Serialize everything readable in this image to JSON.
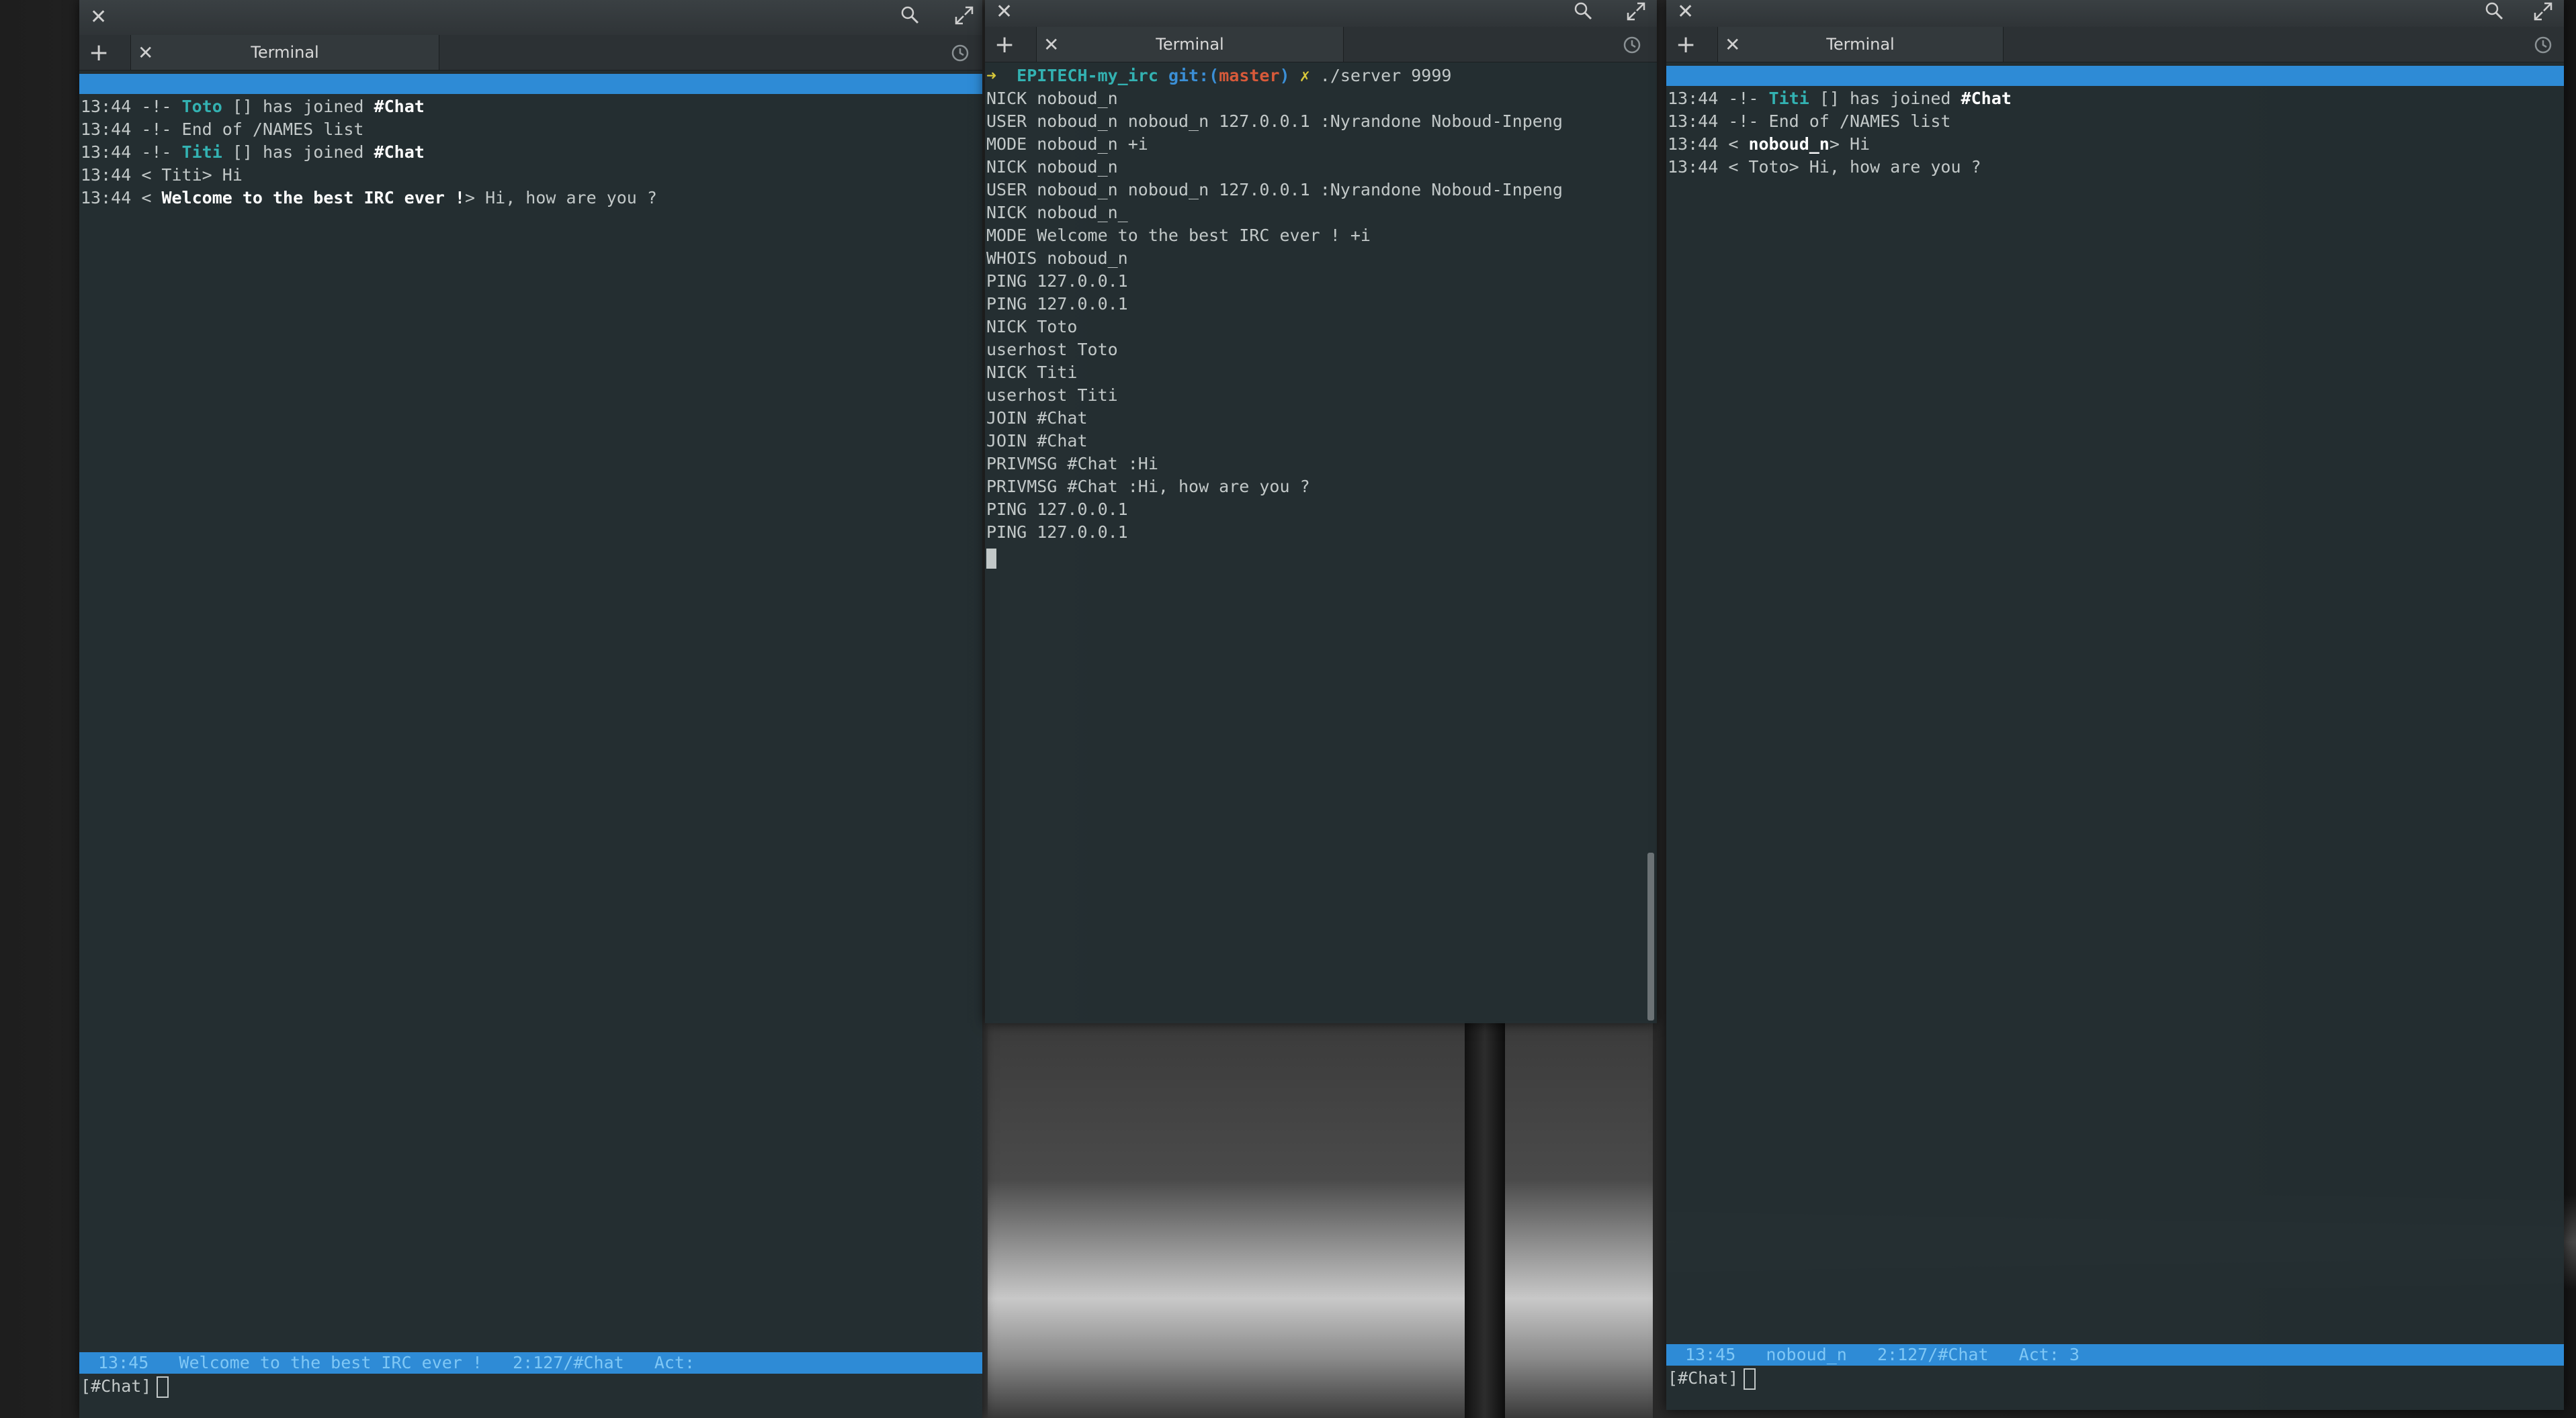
{
  "windows": {
    "left": {
      "tab_title": "Terminal",
      "lines": [
        {
          "time": "13:44",
          "marker": "-!-",
          "nick": "Toto",
          "mid": " [] has joined ",
          "chan": "#Chat"
        },
        {
          "time": "13:44",
          "marker": "-!-",
          "text": " End of /NAMES list"
        },
        {
          "time": "13:44",
          "marker": "-!-",
          "nick": "Titi",
          "mid": " [] has joined ",
          "chan": "#Chat"
        },
        {
          "time": "13:44",
          "plain": "< Titi> Hi"
        },
        {
          "time": "13:44",
          "pre": "< ",
          "bold": "Welcome to the best IRC ever !",
          "post": "> Hi, how are you ?"
        }
      ],
      "status": "13:45   Welcome to the best IRC ever !   2:127/#Chat   Act: ",
      "input": "[#Chat]"
    },
    "middle": {
      "tab_title": "Terminal",
      "prompt": {
        "arrow": "➜",
        "dir": "EPITECH-my_irc",
        "git": "git:(",
        "branch": "master",
        "git_close": ")",
        "x": "✗",
        "cmd": "./server 9999"
      },
      "lines": [
        "NICK noboud_n",
        "USER noboud_n noboud_n 127.0.0.1 :Nyrandone Noboud-Inpeng",
        "MODE noboud_n +i",
        "NICK noboud_n",
        "USER noboud_n noboud_n 127.0.0.1 :Nyrandone Noboud-Inpeng",
        "NICK noboud_n_",
        "MODE Welcome to the best IRC ever ! +i",
        "WHOIS noboud_n",
        "PING 127.0.0.1",
        "PING 127.0.0.1",
        "NICK Toto",
        "userhost Toto",
        "NICK Titi",
        "userhost Titi",
        "JOIN #Chat",
        "JOIN #Chat",
        "PRIVMSG #Chat :Hi",
        "PRIVMSG #Chat :Hi, how are you ?",
        "PING 127.0.0.1",
        "PING 127.0.0.1"
      ]
    },
    "right": {
      "tab_title": "Terminal",
      "lines": [
        {
          "time": "13:44",
          "marker": "-!-",
          "nick": "Titi",
          "mid": " [] has joined ",
          "chan": "#Chat"
        },
        {
          "time": "13:44",
          "marker": "-!-",
          "text": " End of /NAMES list"
        },
        {
          "time": "13:44",
          "pre": "< ",
          "bold": "noboud_n",
          "post": "> Hi"
        },
        {
          "time": "13:44",
          "plain": "< Toto> Hi, how are you ?"
        }
      ],
      "status": "13:45   noboud_n   2:127/#Chat   Act: 3",
      "input": "[#Chat]"
    }
  },
  "icons": {
    "close": "✕",
    "add": "+",
    "search": "search-icon",
    "maximize": "maximize-icon",
    "history": "history-icon"
  },
  "colors": {
    "accent_blue": "#2e8bd6",
    "nick_teal": "#33b2b2",
    "terminal_bg": "#242e32"
  }
}
